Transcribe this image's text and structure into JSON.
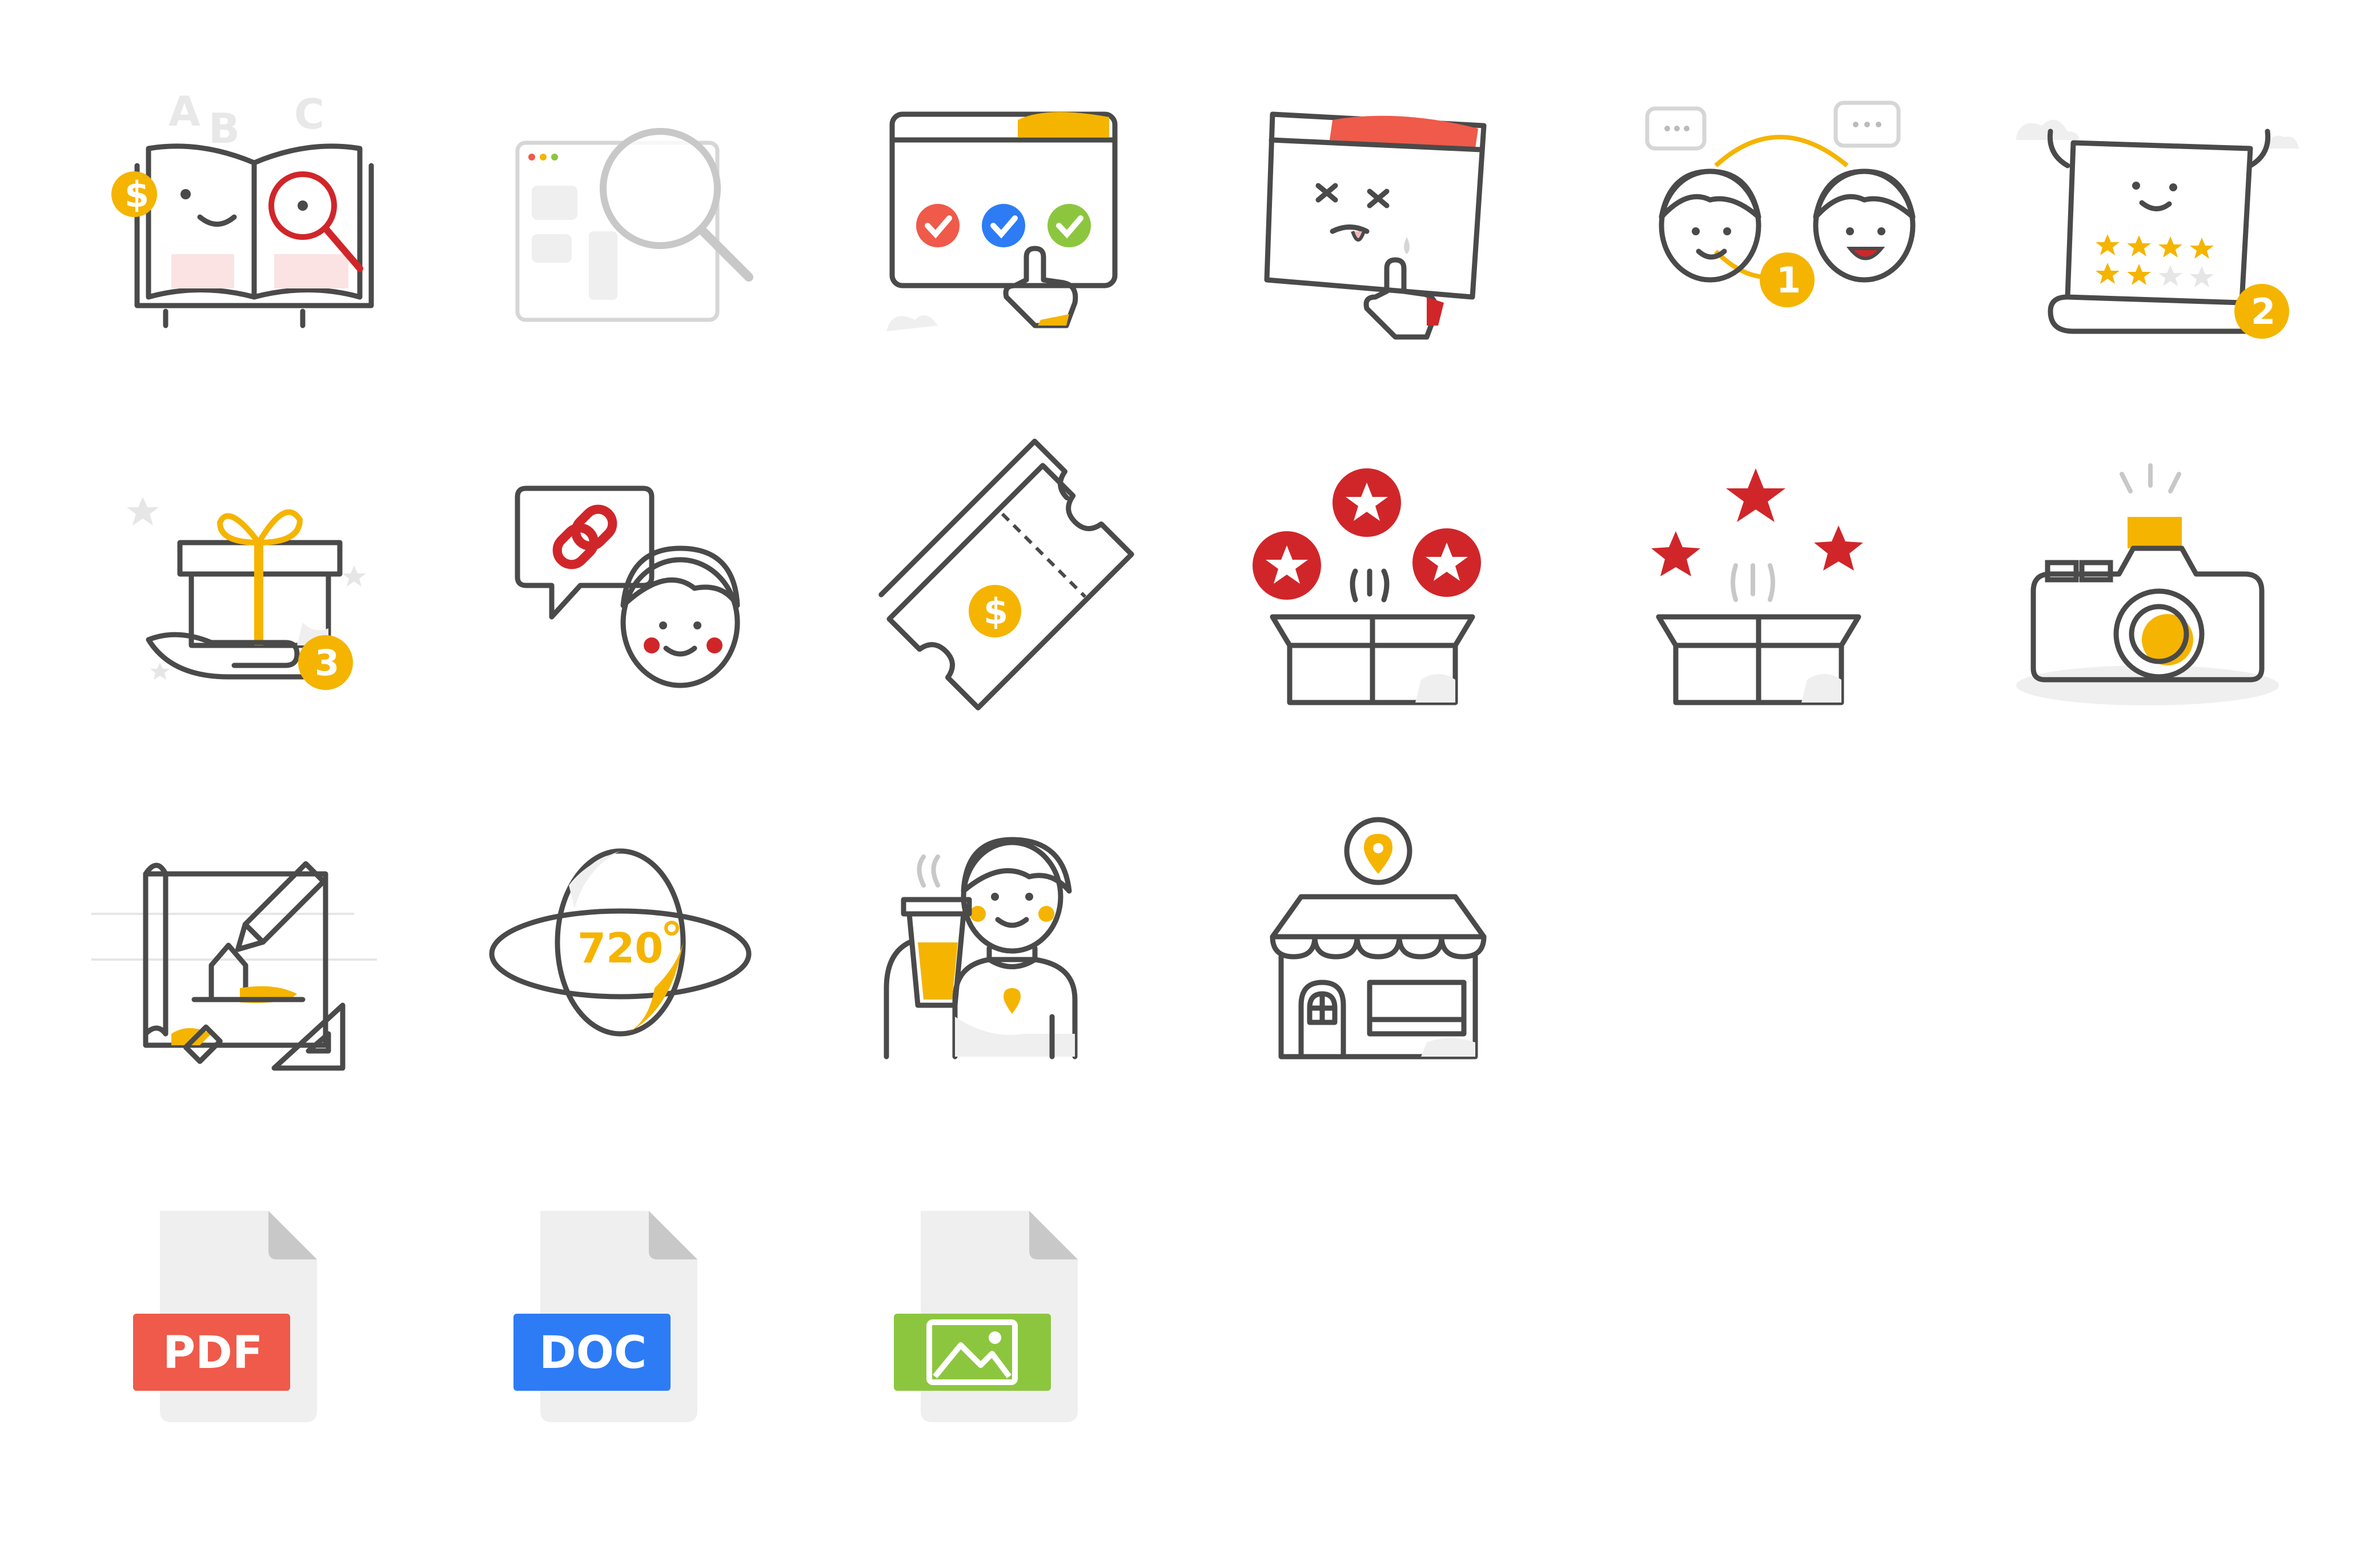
{
  "colors": {
    "outline": "#4a4a4a",
    "accent_yellow": "#f5b400",
    "accent_red": "#d0262a",
    "light_gray": "#efefef",
    "pdf_red": "#ef5a4a",
    "doc_blue": "#2d7cf6",
    "image_green": "#8cc63f"
  },
  "icons": [
    {
      "name": "book-magnifier-icon",
      "letters": [
        "A",
        "B",
        "C"
      ]
    },
    {
      "name": "browser-search-icon"
    },
    {
      "name": "browser-checkmarks-icon"
    },
    {
      "name": "broken-browser-icon"
    },
    {
      "name": "two-users-chat-icon",
      "badge": "1"
    },
    {
      "name": "happy-receipt-stars-icon",
      "badge": "2"
    },
    {
      "name": "gift-hand-icon",
      "badge": "3"
    },
    {
      "name": "share-link-user-icon"
    },
    {
      "name": "ticket-coupon-icon"
    },
    {
      "name": "box-red-stars-icon"
    },
    {
      "name": "box-stars-icon"
    },
    {
      "name": "camera-icon"
    },
    {
      "name": "blueprint-house-icon"
    },
    {
      "name": "view-720-icon",
      "label": "720"
    },
    {
      "name": "barista-person-icon"
    },
    {
      "name": "shop-location-icon"
    },
    {
      "name": "pdf-file-icon",
      "label": "PDF"
    },
    {
      "name": "doc-file-icon",
      "label": "DOC"
    },
    {
      "name": "image-file-icon"
    }
  ]
}
